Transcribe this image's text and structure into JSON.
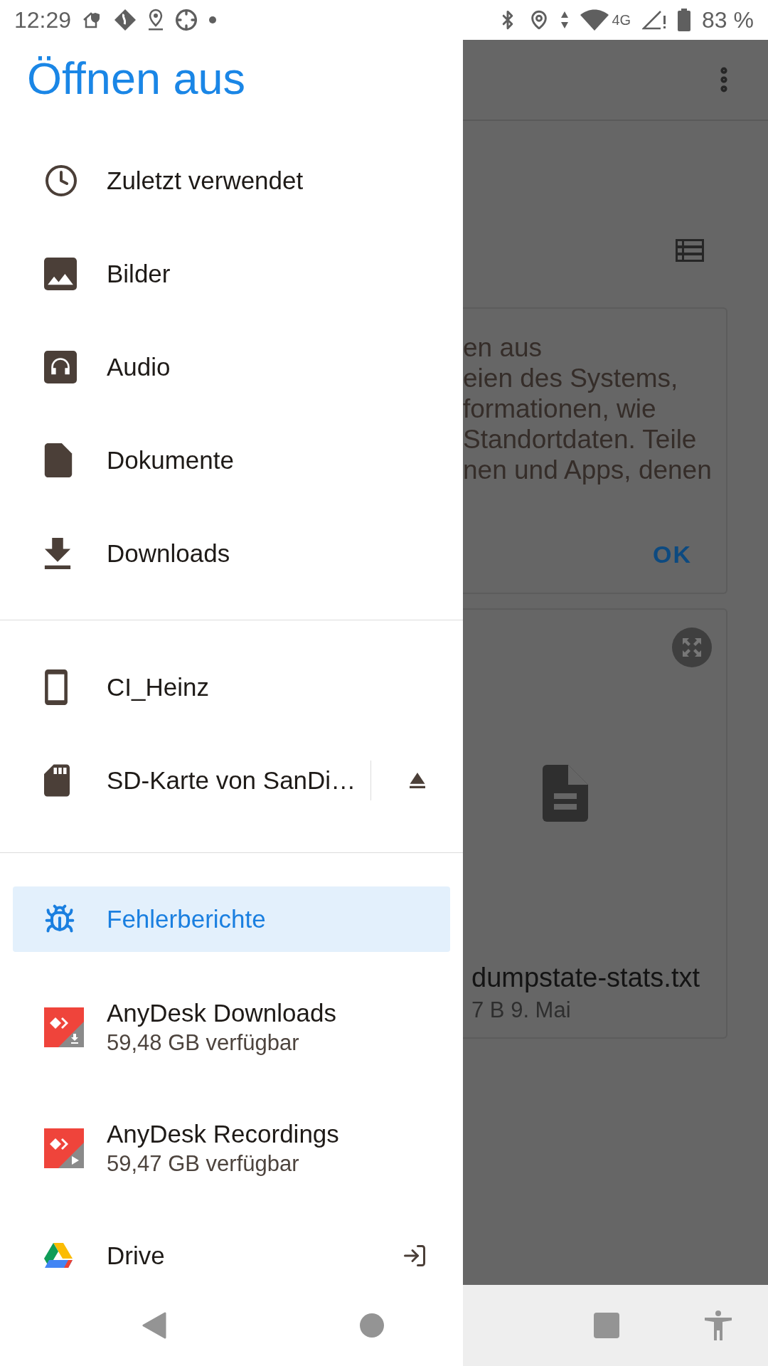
{
  "status_bar": {
    "time": "12:29",
    "network": "4G",
    "battery": "83 %"
  },
  "drawer": {
    "title": "Öffnen aus",
    "sections": [
      {
        "items": [
          {
            "kind": "recent",
            "label": "Zuletzt verwendet",
            "selected": false
          },
          {
            "kind": "images",
            "label": "Bilder",
            "selected": false
          },
          {
            "kind": "audio",
            "label": "Audio",
            "selected": false
          },
          {
            "kind": "documents",
            "label": "Dokumente",
            "selected": false
          },
          {
            "kind": "downloads",
            "label": "Downloads",
            "selected": false
          }
        ]
      },
      {
        "items": [
          {
            "kind": "phone",
            "label": "CI_Heinz",
            "selected": false
          },
          {
            "kind": "sdcard",
            "label": "SD-Karte von SanDi…",
            "trailing": {
              "kind": "eject"
            },
            "selected": false
          }
        ]
      },
      {
        "items": [
          {
            "kind": "bug",
            "label": "Fehlerberichte",
            "selected": true
          },
          {
            "kind": "anydesk-download",
            "label": "AnyDesk Downloads",
            "subtitle": "59,48 GB verfügbar",
            "selected": false
          },
          {
            "kind": "anydesk-record",
            "label": "AnyDesk Recordings",
            "subtitle": "59,47 GB verfügbar",
            "selected": false
          },
          {
            "kind": "drive",
            "label": "Drive",
            "trailing": {
              "kind": "open"
            },
            "selected": false
          }
        ]
      }
    ]
  },
  "background": {
    "message_lines": [
      "en aus",
      "eien des Systems,",
      "formationen, wie",
      "Standortdaten. Teile",
      "nen und Apps, denen"
    ],
    "ok_button": "OK",
    "file": {
      "name": "dumpstate-stats.txt",
      "meta": "7 B 9. Mai"
    }
  }
}
